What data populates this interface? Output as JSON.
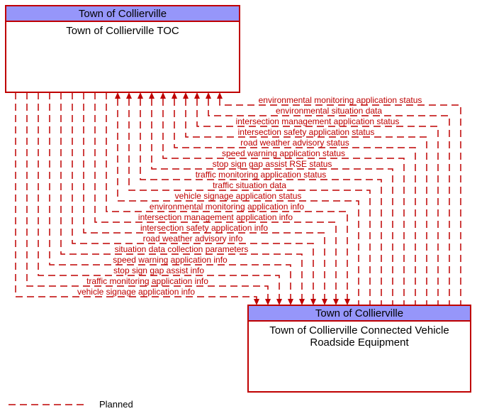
{
  "chart_data": {
    "type": "diagram",
    "nodes": [
      {
        "id": "toc",
        "owner": "Town of Collierville",
        "title": "Town of Collierville TOC"
      },
      {
        "id": "cvre",
        "owner": "Town of Collierville",
        "title": "Town of Collierville Connected Vehicle Roadside Equipment"
      }
    ],
    "flows_to_toc": [
      "environmental monitoring application status",
      "environmental situation data",
      "intersection management application status",
      "intersection safety application status",
      "road weather advisory status",
      "speed warning application status",
      "stop sign gap assist RSE status",
      "traffic monitoring application status",
      "traffic situation data",
      "vehicle signage application status"
    ],
    "flows_to_cvre": [
      "environmental monitoring application info",
      "intersection management application info",
      "intersection safety application info",
      "road weather advisory info",
      "situation data collection parameters",
      "speed warning application info",
      "stop sign gap assist info",
      "traffic monitoring application info",
      "vehicle signage application info"
    ],
    "legend": "Planned",
    "flow_style": "planned",
    "colors": {
      "line": "#bf0000",
      "header": "#9696fa"
    }
  }
}
